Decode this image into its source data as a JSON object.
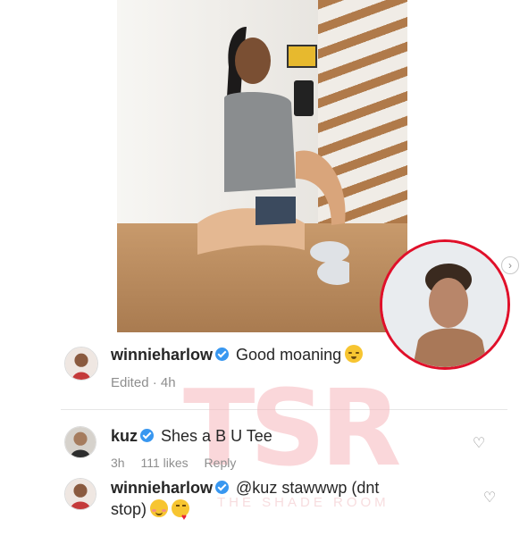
{
  "post": {
    "next_icon": "chevron-right-icon"
  },
  "caption": {
    "username": "winnieharlow",
    "text": "Good moaning",
    "emoji": "sleepy-face",
    "edited": "Edited",
    "time": "4h"
  },
  "comments": [
    {
      "username": "kuz",
      "text": "Shes a B U Tee",
      "time": "3h",
      "likes": "111 likes",
      "reply": "Reply"
    },
    {
      "username": "winnieharlow",
      "text_line1": "@kuz stawwwp (dnt",
      "text_line2": "stop)",
      "emojis": [
        "smiling-face",
        "kissing-face"
      ]
    }
  ],
  "watermark": {
    "letters": "TSR",
    "subtitle": "THE SHADE ROOM"
  },
  "colors": {
    "verified": "#3897f0",
    "story_ring": "#e0102a",
    "watermark": "#f7b7bd"
  }
}
